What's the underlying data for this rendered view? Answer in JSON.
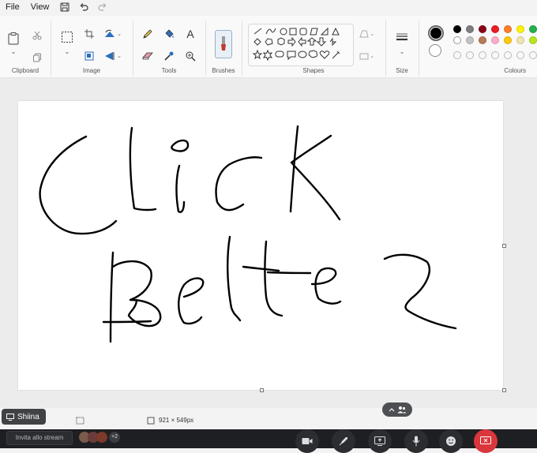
{
  "menu": {
    "file": "File",
    "view": "View"
  },
  "groups": {
    "clipboard": "Clipboard",
    "image": "Image",
    "tools": "Tools",
    "brushes": "Brushes",
    "shapes": "Shapes",
    "size": "Size",
    "colours": "Colours"
  },
  "tools": {
    "text_glyph": "A"
  },
  "colors": {
    "primary": "#000000",
    "secondary": "#ffffff",
    "palette_row1": [
      "#000000",
      "#7f7f7f",
      "#880015",
      "#ed1c24",
      "#ff7f27",
      "#fff200",
      "#22b14c"
    ],
    "palette_row2": [
      "#ffffff",
      "#c3c3c3",
      "#b97a57",
      "#ffaec9",
      "#ffc90e",
      "#efe4b0",
      "#b5e61d"
    ]
  },
  "status": {
    "canvas_size": "921 × 549px"
  },
  "overlay": {
    "user_name": "Shiina",
    "invite_text": "Invita allo stream",
    "extra_count": "+2"
  }
}
